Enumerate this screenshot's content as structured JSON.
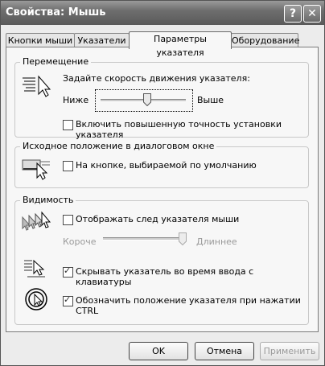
{
  "window": {
    "title": "Свойства: Мышь",
    "help_glyph": "?",
    "close_glyph": "✕"
  },
  "tabs": [
    {
      "label": "Кнопки мыши"
    },
    {
      "label": "Указатели"
    },
    {
      "label": "Параметры указателя",
      "active": true
    },
    {
      "label": "Оборудование"
    }
  ],
  "motion": {
    "group_label": "Перемещение",
    "speed_label": "Задайте скорость движения указателя:",
    "slow_label": "Ниже",
    "fast_label": "Выше",
    "speed_value_fraction": 0.55,
    "precision_label": "Включить повышенную точность установки указателя",
    "precision_checked": false
  },
  "snap": {
    "group_label": "Исходное положение в диалоговом окне",
    "snap_label": "На кнопке, выбираемой по умолчанию",
    "snap_checked": false
  },
  "visibility": {
    "group_label": "Видимость",
    "trails_label": "Отображать след указателя мыши",
    "trails_checked": false,
    "short_label": "Короче",
    "long_label": "Длиннее",
    "trails_value_fraction": 0.95,
    "hide_label": "Скрывать указатель во время ввода с клавиатуры",
    "hide_checked": true,
    "ctrl_label": "Обозначить положение указателя при нажатии CTRL",
    "ctrl_checked": true
  },
  "buttons": {
    "ok": "OK",
    "cancel": "Отмена",
    "apply": "Применить"
  },
  "colors": {
    "titlebar": "#6e6e6e",
    "dialog_bg": "#ececec",
    "panel_bg": "#f7f7f7",
    "disabled_text": "#9a9a9a"
  }
}
